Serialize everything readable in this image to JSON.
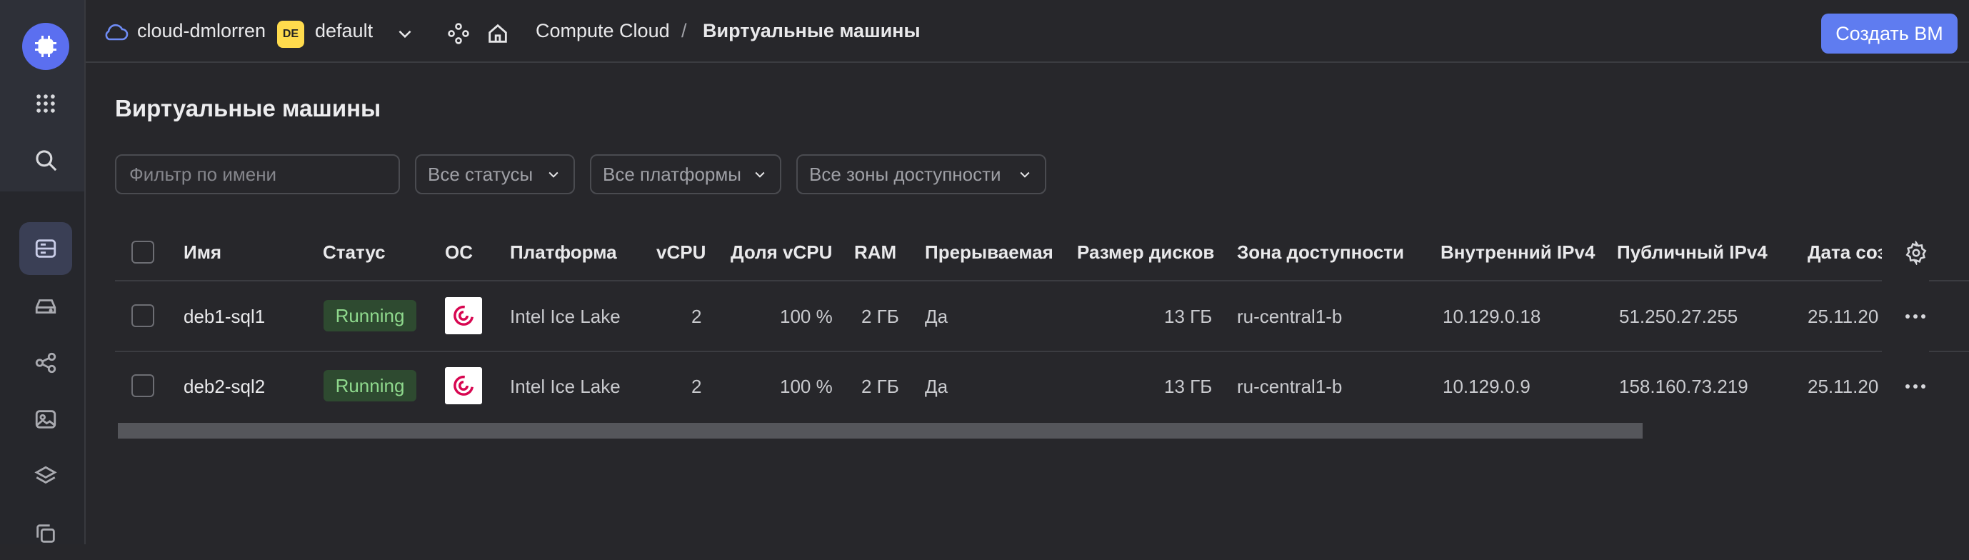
{
  "header": {
    "cloud_name": "cloud-dmlorren",
    "folder_badge": "DE",
    "folder_name": "default",
    "breadcrumb_service": "Compute Cloud",
    "breadcrumb_separator": "/",
    "breadcrumb_current": "Виртуальные машины",
    "create_button": "Создать ВМ"
  },
  "page": {
    "title": "Виртуальные машины"
  },
  "filters": {
    "name_placeholder": "Фильтр по имени",
    "status": "Все статусы",
    "platform": "Все платформы",
    "zone": "Все зоны доступности"
  },
  "table": {
    "columns": [
      "Имя",
      "Статус",
      "ОС",
      "Платформа",
      "vCPU",
      "Доля vCPU",
      "RAM",
      "Прерываемая",
      "Размер дисков",
      "Зона доступности",
      "Внутренний IPv4",
      "Публичный IPv4",
      "Дата соз"
    ],
    "rows": [
      {
        "name": "deb1-sql1",
        "status": "Running",
        "platform": "Intel Ice Lake",
        "vcpu": "2",
        "vcpu_share": "100 %",
        "ram": "2 ГБ",
        "preemptible": "Да",
        "disk_size": "13 ГБ",
        "zone": "ru-central1-b",
        "internal_ip": "10.129.0.18",
        "public_ip": "51.250.27.255",
        "created": "25.11.20"
      },
      {
        "name": "deb2-sql2",
        "status": "Running",
        "platform": "Intel Ice Lake",
        "vcpu": "2",
        "vcpu_share": "100 %",
        "ram": "2 ГБ",
        "preemptible": "Да",
        "disk_size": "13 ГБ",
        "zone": "ru-central1-b",
        "internal_ip": "10.129.0.9",
        "public_ip": "158.160.73.219",
        "created": "25.11.20"
      }
    ]
  },
  "colors": {
    "accent": "#5f7cf0",
    "status_running_bg": "#2e4a30",
    "status_running_text": "#8fd98d",
    "background": "#27272b"
  },
  "icons": {
    "logo": "compute-chip-icon",
    "rail": [
      "apps-grid-icon",
      "search-icon",
      "server-icon",
      "disk-icon",
      "share-nodes-icon",
      "image-icon",
      "layers-icon",
      "copy-icon"
    ],
    "header": [
      "cloud-icon",
      "chevron-down-icon",
      "nodes-icon",
      "home-icon"
    ],
    "table": [
      "settings-gear-icon",
      "more-dots-icon",
      "debian-logo-icon"
    ]
  }
}
